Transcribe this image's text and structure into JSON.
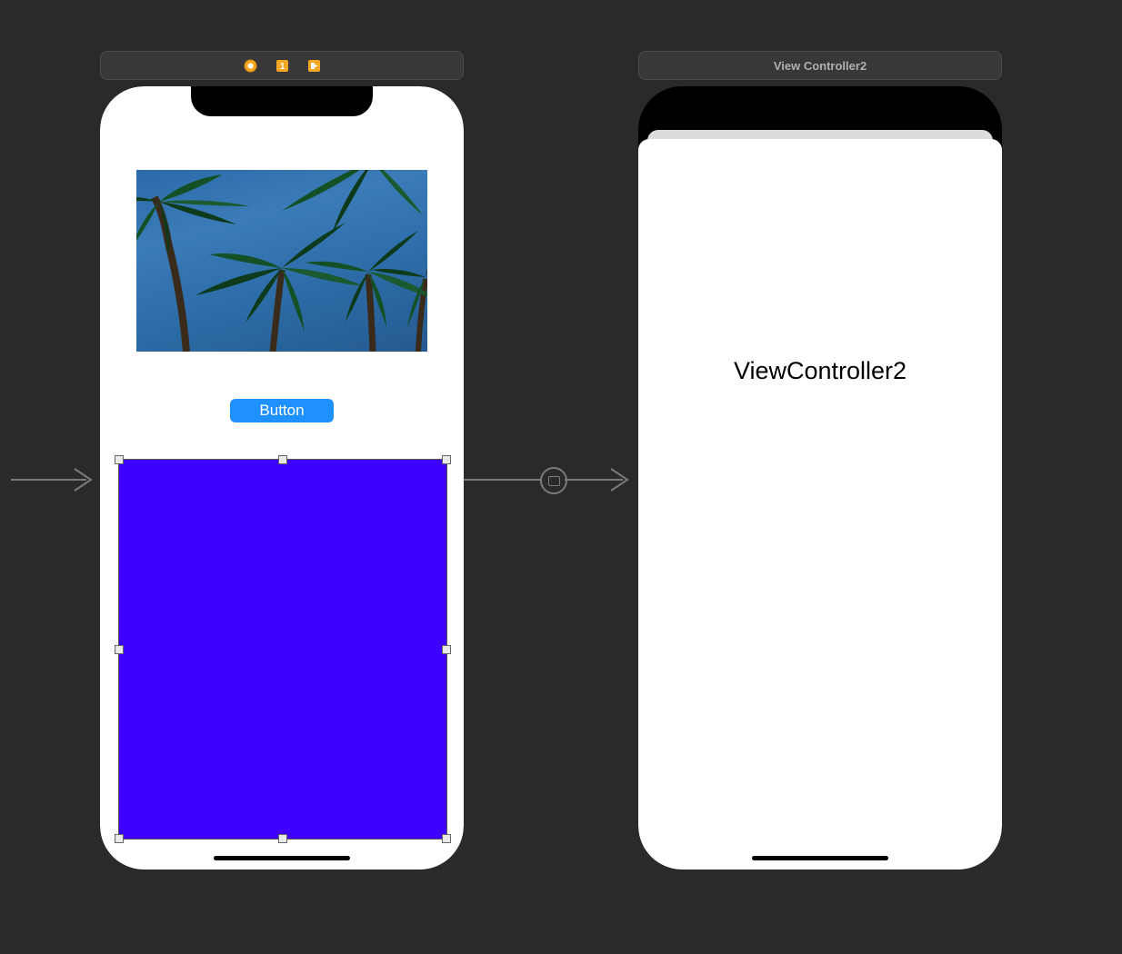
{
  "scene1": {
    "title": "",
    "icons": {
      "vc": "vc-icon",
      "first": "first-responder-icon",
      "exit": "exit-icon"
    }
  },
  "scene2": {
    "title": "View Controller2"
  },
  "vc1": {
    "button_label": "Button",
    "image_semantic": "palm-trees-image",
    "selected_view_color": "#3e00ff"
  },
  "vc2": {
    "label_text": "ViewController2"
  }
}
